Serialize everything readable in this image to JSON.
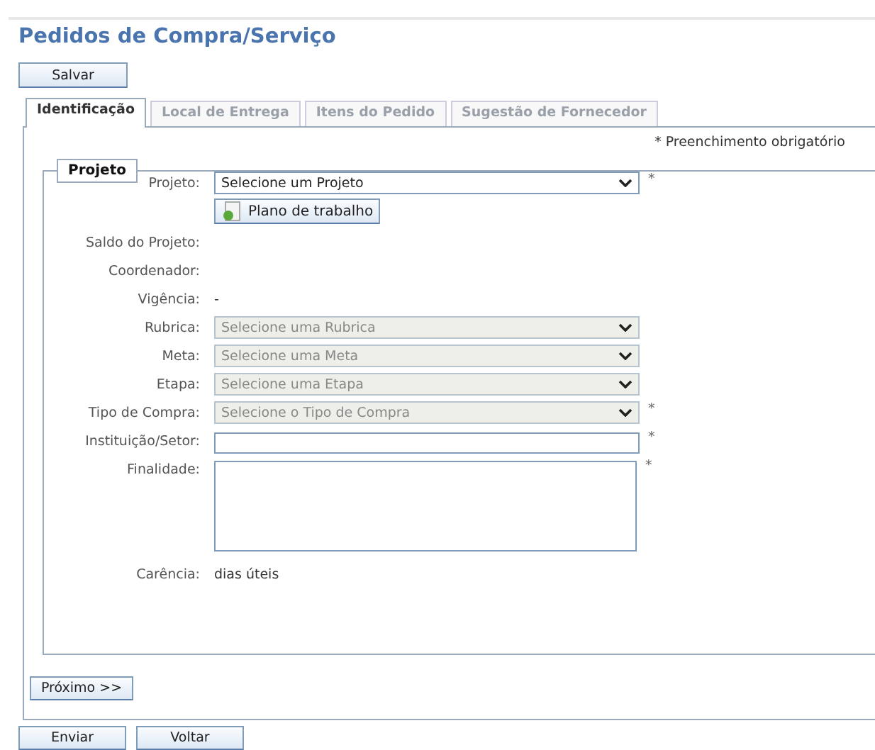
{
  "title": "Pedidos de Compra/Serviço",
  "save_button": "Salvar",
  "tabs": [
    {
      "label": "Identificação",
      "selected": true
    },
    {
      "label": "Local de Entrega",
      "selected": false
    },
    {
      "label": "Itens do Pedido",
      "selected": false
    },
    {
      "label": "Sugestão de Fornecedor",
      "selected": false
    }
  ],
  "required_note": "* Preenchimento obrigatório",
  "section": {
    "legend": "Projeto",
    "fields": [
      {
        "kind": "select",
        "label": "Projeto:",
        "value": "Selecione um Projeto",
        "disabled": false,
        "mark": "*",
        "button": "Plano de trabalho"
      },
      {
        "kind": "static",
        "label": "Saldo do Projeto:"
      },
      {
        "kind": "static",
        "label": "Coordenador:"
      },
      {
        "kind": "static",
        "label": "Vigência:",
        "value": "-"
      },
      {
        "kind": "select",
        "label": "Rubrica:",
        "value": "Selecione uma Rubrica",
        "disabled": true
      },
      {
        "kind": "select",
        "label": "Meta:",
        "value": "Selecione uma Meta",
        "disabled": true
      },
      {
        "kind": "select",
        "label": "Etapa:",
        "value": "Selecione uma Etapa",
        "disabled": true
      },
      {
        "kind": "select",
        "label": "Tipo de Compra:",
        "value": "Selecione o Tipo de Compra",
        "disabled": true,
        "mark": "*"
      },
      {
        "kind": "input",
        "label": "Instituição/Setor:",
        "mark": "*"
      },
      {
        "kind": "textarea",
        "label": "Finalidade:",
        "mark": "*"
      },
      {
        "kind": "static",
        "label": "Carência:",
        "value": "dias úteis"
      }
    ]
  },
  "next_button": "Próximo >>",
  "footer_buttons": [
    "Enviar",
    "Voltar"
  ]
}
